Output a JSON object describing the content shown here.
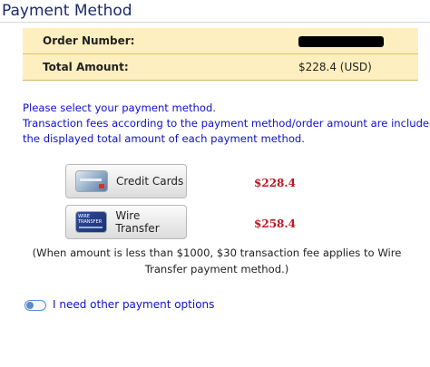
{
  "header": {
    "title": "Payment Method"
  },
  "order": {
    "order_number_label": "Order Number:",
    "order_number_value": "",
    "total_label": "Total Amount:",
    "total_value": "$228.4 (USD)"
  },
  "notice": {
    "line1": "Please select your payment method.",
    "line2": "Transaction fees according to the payment method/order amount are included in",
    "line3": "the displayed total amount of each payment method."
  },
  "methods": [
    {
      "label": "Credit Cards",
      "price": "$228.4",
      "icon": "credit-card-icon"
    },
    {
      "label": "Wire Transfer",
      "price": "$258.4",
      "icon": "wire-transfer-icon"
    }
  ],
  "fee_note": {
    "line1": "(When amount is less than $1000, $30 transaction fee applies to Wire",
    "line2": "Transfer payment method.)"
  },
  "other_options": {
    "label": "I need other payment options",
    "enabled": false
  },
  "colors": {
    "table_bg": "#fdefbf",
    "notice_text": "#1010cc",
    "price_text": "#c01521",
    "title_text": "#1a2a6a"
  }
}
